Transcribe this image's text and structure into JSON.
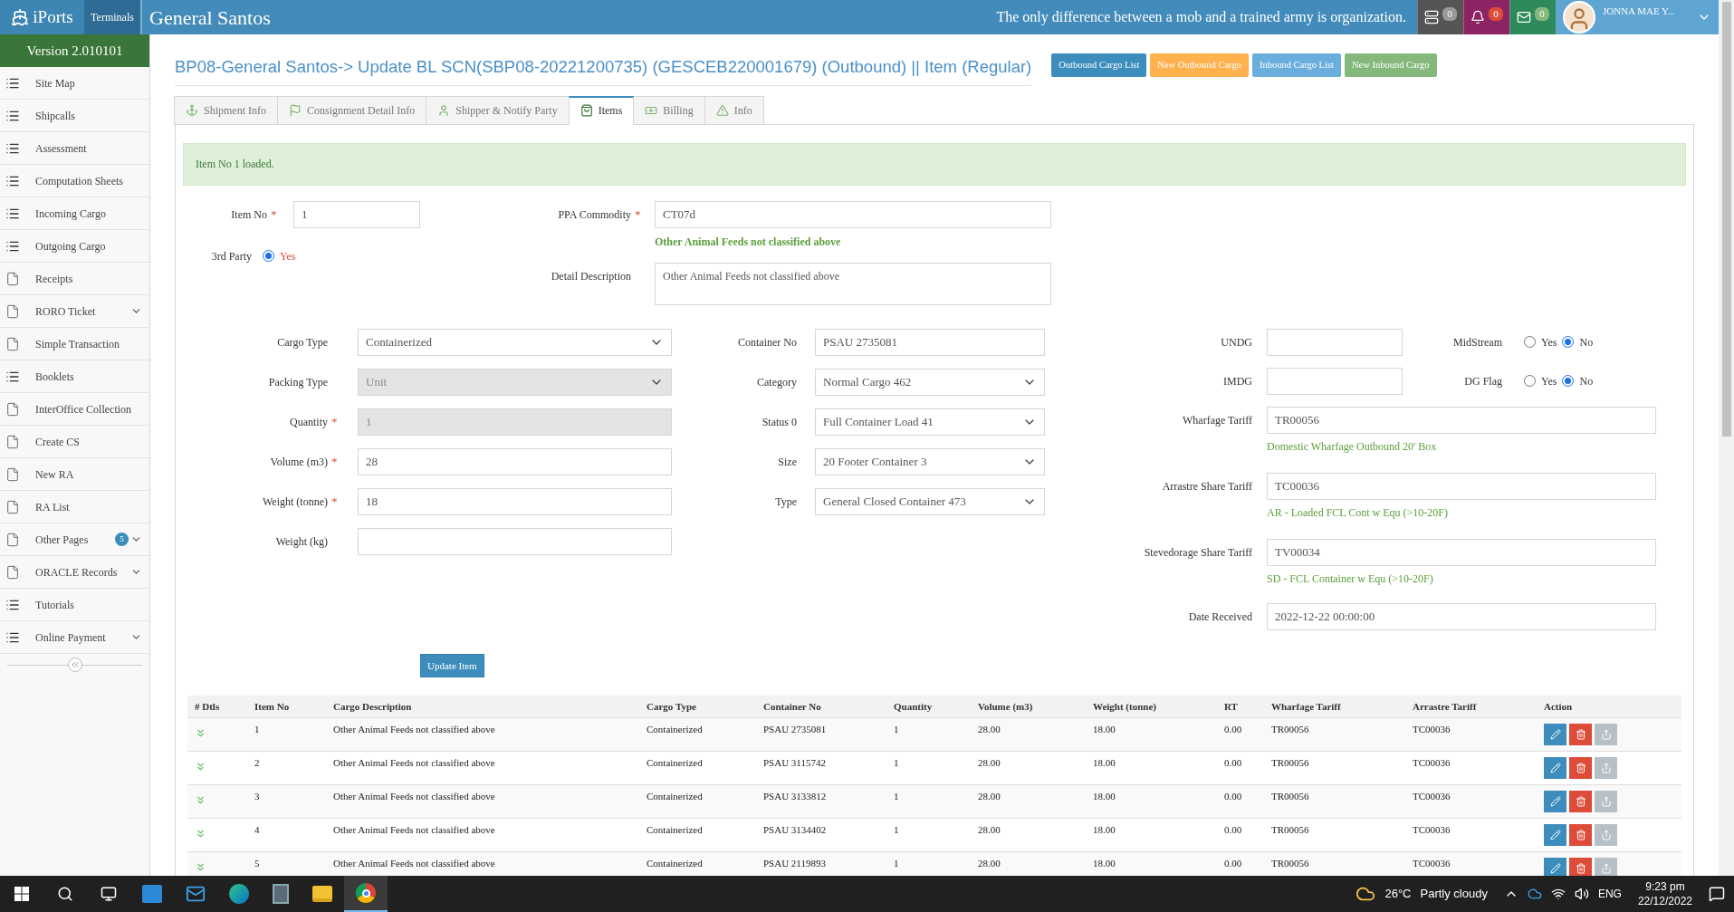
{
  "brand": {
    "name": "iPorts",
    "terminals": "Terminals",
    "location": "General Santos"
  },
  "quote": "The only difference between a mob and a trained army is organization.",
  "notifications": [
    {
      "kind": "tasks",
      "count": "0"
    },
    {
      "kind": "alerts",
      "count": "0"
    },
    {
      "kind": "messages",
      "count": "0"
    }
  ],
  "user": {
    "name": "JONNA MAE Y..."
  },
  "sidebar": {
    "version": "Version 2.010101",
    "items": [
      {
        "label": "Site Map",
        "kind": "list",
        "expandable": false
      },
      {
        "label": "Shipcalls",
        "kind": "list",
        "expandable": false
      },
      {
        "label": "Assessment",
        "kind": "list",
        "expandable": false
      },
      {
        "label": "Computation Sheets",
        "kind": "list",
        "expandable": false
      },
      {
        "label": "Incoming Cargo",
        "kind": "list",
        "expandable": false
      },
      {
        "label": "Outgoing Cargo",
        "kind": "list",
        "expandable": false
      },
      {
        "label": "Receipts",
        "kind": "page",
        "expandable": false
      },
      {
        "label": "RORO Ticket",
        "kind": "page",
        "expandable": true
      },
      {
        "label": "Simple Transaction",
        "kind": "page",
        "expandable": false
      },
      {
        "label": "Booklets",
        "kind": "list",
        "expandable": false
      },
      {
        "label": "InterOffice Collection",
        "kind": "page",
        "expandable": false
      },
      {
        "label": "Create CS",
        "kind": "page",
        "expandable": false
      },
      {
        "label": "New RA",
        "kind": "page",
        "expandable": false
      },
      {
        "label": "RA List",
        "kind": "page",
        "expandable": false
      },
      {
        "label": "Other Pages",
        "kind": "page",
        "expandable": true,
        "badge": "5"
      },
      {
        "label": "ORACLE Records",
        "kind": "page",
        "expandable": true
      },
      {
        "label": "Tutorials",
        "kind": "list",
        "expandable": false
      },
      {
        "label": "Online Payment",
        "kind": "list",
        "expandable": true
      }
    ]
  },
  "page_title": "BP08-General Santos-> Update BL SCN(SBP08-20221200735) (GESCEB220001679) (Outbound) || Item (Regular)",
  "action_buttons": [
    {
      "label": "Outbound Cargo List",
      "color": "#3c8dbc"
    },
    {
      "label": "New Outbound Cargo",
      "color": "#ffb14e"
    },
    {
      "label": "Inbound Cargo List",
      "color": "#6aaede"
    },
    {
      "label": "New Inbound Cargo",
      "color": "#84b97b"
    }
  ],
  "tabs": [
    {
      "label": "Shipment Info",
      "kind": "anchor",
      "selected": false
    },
    {
      "label": "Consignment Detail Info",
      "kind": "flag",
      "selected": false
    },
    {
      "label": "Shipper & Notify Party",
      "kind": "person",
      "selected": false
    },
    {
      "label": "Items",
      "kind": "bag",
      "selected": true
    },
    {
      "label": "Billing",
      "kind": "money",
      "selected": false
    },
    {
      "label": "Info",
      "kind": "warning",
      "selected": false
    }
  ],
  "alert": "Item No 1 loaded.",
  "form": {
    "item_no": {
      "label": "Item No",
      "required_mark": "*",
      "value": "1"
    },
    "third_party": {
      "label": "3rd Party",
      "option": "Yes",
      "selected": true
    },
    "ppa_commodity": {
      "label": "PPA Commodity",
      "required_mark": "*",
      "value": "CT07d",
      "hint": "Other Animal Feeds not classified above"
    },
    "detail_description": {
      "label": "Detail Description",
      "value": "Other Animal Feeds not classified above"
    },
    "cargo_fields": [
      {
        "label": "Cargo Type",
        "kind": "select",
        "disabled": false,
        "value": "Containerized"
      },
      {
        "label": "Packing Type",
        "kind": "select",
        "disabled": true,
        "value": "Unit"
      },
      {
        "label": "Quantity",
        "required_mark": "*",
        "kind": "input",
        "disabled": true,
        "value": "1"
      },
      {
        "label": "Volume (m3)",
        "required_mark": "*",
        "kind": "input",
        "disabled": false,
        "value": "28"
      },
      {
        "label": "Weight (tonne)",
        "required_mark": "*",
        "kind": "input",
        "disabled": false,
        "value": "18"
      },
      {
        "label": "Weight (kg)",
        "kind": "input",
        "disabled": false
      }
    ],
    "container_fields": [
      {
        "label": "Container No",
        "kind": "input",
        "value": "PSAU 2735081"
      },
      {
        "label": "Category",
        "kind": "select",
        "value": "Normal Cargo 462"
      },
      {
        "label": "Status 0",
        "kind": "select",
        "value": "Full Container Load 41"
      },
      {
        "label": "Size",
        "kind": "select",
        "value": "20 Footer Container 3"
      },
      {
        "label": "Type",
        "kind": "select",
        "value": "General Closed Container 473"
      }
    ],
    "codes": [
      {
        "label": "UNDG"
      },
      {
        "label": "IMDG"
      }
    ],
    "flags": [
      {
        "label": "MidStream",
        "options": [
          {
            "label": "Yes",
            "selected": false
          },
          {
            "label": "No",
            "selected": true
          }
        ]
      },
      {
        "label": "DG Flag",
        "options": [
          {
            "label": "Yes",
            "selected": false
          },
          {
            "label": "No",
            "selected": true
          }
        ]
      }
    ],
    "tariffs": [
      {
        "label": "Wharfage Tariff",
        "value": "TR00056",
        "hint": "Domestic Wharfage Outbound 20' Box"
      },
      {
        "label": "Arrastre Share Tariff",
        "value": "TC00036",
        "hint": "AR - Loaded FCL Cont w Equ (>10-20F)"
      },
      {
        "label": "Stevedorage Share Tariff",
        "value": "TV00034",
        "hint": "SD - FCL Container w Equ (>10-20F)"
      }
    ],
    "date_received": {
      "label": "Date Received",
      "value": "2022-12-22 00:00:00"
    },
    "submit": "Update Item"
  },
  "table": {
    "columns": [
      "# Dtls",
      "Item No",
      "Cargo Description",
      "Cargo Type",
      "Container No",
      "Quantity",
      "Volume (m3)",
      "Weight (tonne)",
      "RT",
      "Wharfage Tariff",
      "Arrastre Tariff",
      "Action"
    ],
    "rows": [
      [
        "",
        "1",
        "Other Animal Feeds not classified above",
        "Containerized",
        "PSAU 2735081",
        "1",
        "28.00",
        "18.00",
        "0.00",
        "TR00056",
        "TC00036",
        ""
      ],
      [
        "",
        "2",
        "Other Animal Feeds not classified above",
        "Containerized",
        "PSAU 3115742",
        "1",
        "28.00",
        "18.00",
        "0.00",
        "TR00056",
        "TC00036",
        ""
      ],
      [
        "",
        "3",
        "Other Animal Feeds not classified above",
        "Containerized",
        "PSAU 3133812",
        "1",
        "28.00",
        "18.00",
        "0.00",
        "TR00056",
        "TC00036",
        ""
      ],
      [
        "",
        "4",
        "Other Animal Feeds not classified above",
        "Containerized",
        "PSAU 3134402",
        "1",
        "28.00",
        "18.00",
        "0.00",
        "TR00056",
        "TC00036",
        ""
      ],
      [
        "",
        "5",
        "Other Animal Feeds not classified above",
        "Containerized",
        "PSAU 2119893",
        "1",
        "28.00",
        "18.00",
        "0.00",
        "TR00056",
        "TC00036",
        ""
      ]
    ]
  },
  "taskbar": {
    "temperature": "26°C",
    "weather": "Partly cloudy",
    "language": "ENG",
    "time": "9:23 pm",
    "date": "22/12/2022"
  }
}
